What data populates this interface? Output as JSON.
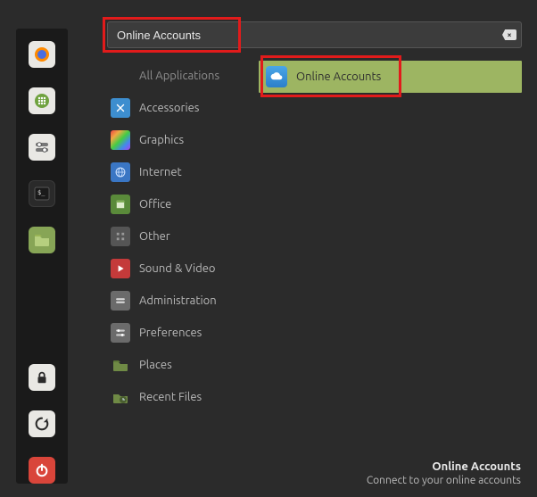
{
  "search": {
    "value": "Online Accounts"
  },
  "categories": [
    {
      "label": "All Applications",
      "icon": "allapps"
    },
    {
      "label": "Accessories",
      "icon": "accessories"
    },
    {
      "label": "Graphics",
      "icon": "graphics"
    },
    {
      "label": "Internet",
      "icon": "internet"
    },
    {
      "label": "Office",
      "icon": "office"
    },
    {
      "label": "Other",
      "icon": "other"
    },
    {
      "label": "Sound & Video",
      "icon": "sound-video"
    },
    {
      "label": "Administration",
      "icon": "administration"
    },
    {
      "label": "Preferences",
      "icon": "preferences"
    },
    {
      "label": "Places",
      "icon": "places"
    },
    {
      "label": "Recent Files",
      "icon": "recent"
    }
  ],
  "result": {
    "label": "Online Accounts"
  },
  "footer": {
    "title": "Online Accounts",
    "subtitle": "Connect to your online accounts"
  },
  "launcher": [
    "firefox",
    "apps",
    "settings-toggle",
    "terminal",
    "files",
    "lock",
    "refresh",
    "power"
  ]
}
